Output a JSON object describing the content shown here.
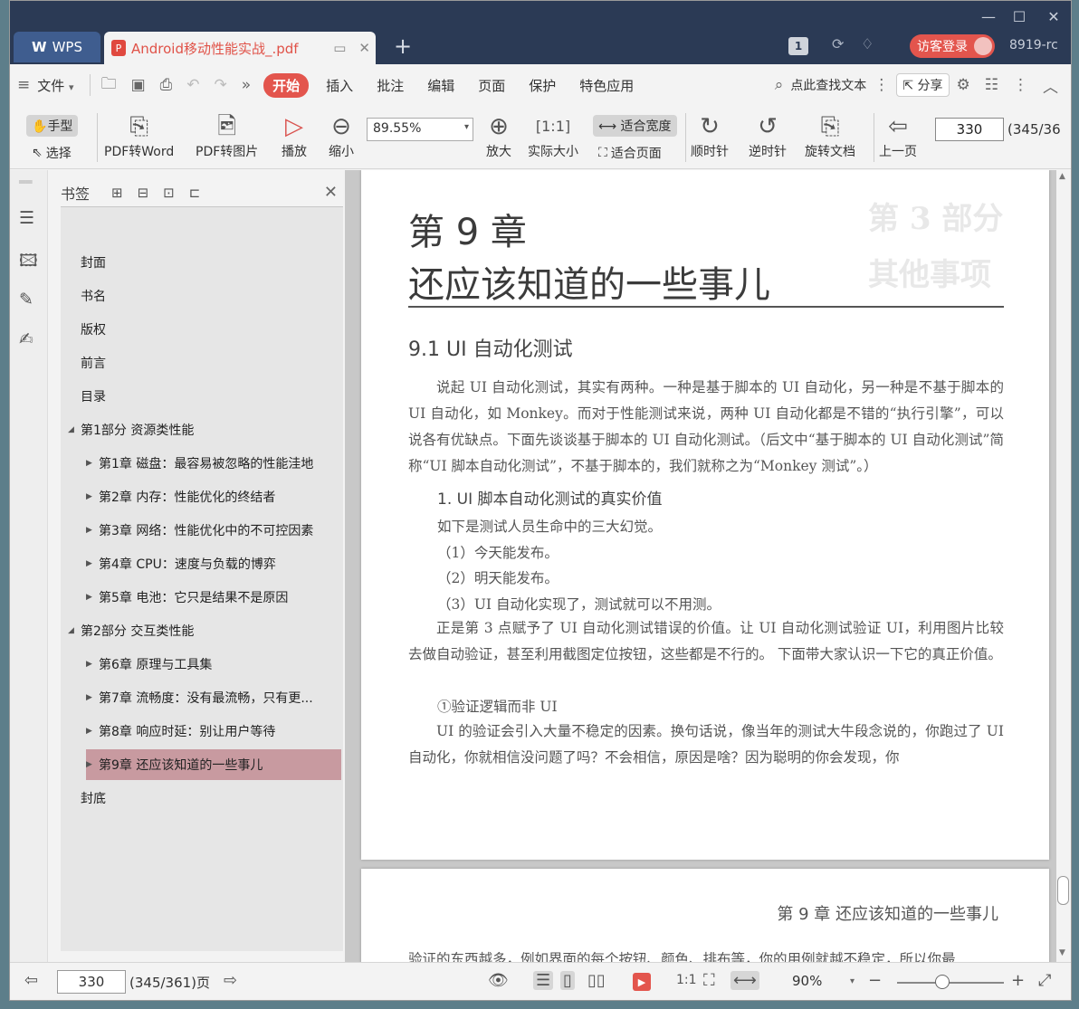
{
  "titlebar": {
    "app_tab": "WPS",
    "doc_tab": "Android移动性能实战_.pdf",
    "page_badge": "1",
    "guest_login": "访客登录",
    "user_code": "8919-rc"
  },
  "menu": {
    "file": "文件",
    "tabs": [
      "开始",
      "插入",
      "批注",
      "编辑",
      "页面",
      "保护",
      "特色应用"
    ],
    "search_text": "点此查找文本",
    "share": "分享"
  },
  "ribbon": {
    "hand": "手型",
    "select": "选择",
    "pdf_to_word": "PDF转Word",
    "pdf_to_image": "PDF转图片",
    "play": "播放",
    "zoom_out": "缩小",
    "zoom_value": "89.55%",
    "zoom_in": "放大",
    "actual_size": "实际大小",
    "fit_width": "适合宽度",
    "fit_page": "适合页面",
    "rotate_cw": "顺时针",
    "rotate_ccw": "逆时针",
    "rotate_doc": "旋转文档",
    "prev_page": "上一页",
    "page_current": "330",
    "page_total": "(345/36"
  },
  "bookmarks": {
    "title": "书签",
    "items": [
      {
        "label": "封面",
        "level": 0,
        "arrow": ""
      },
      {
        "label": "书名",
        "level": 0,
        "arrow": ""
      },
      {
        "label": "版权",
        "level": 0,
        "arrow": ""
      },
      {
        "label": "前言",
        "level": 0,
        "arrow": ""
      },
      {
        "label": "目录",
        "level": 0,
        "arrow": ""
      },
      {
        "label": "第1部分  资源类性能",
        "level": 0,
        "arrow": "◢"
      },
      {
        "label": "第1章  磁盘：最容易被忽略的性能洼地",
        "level": 1,
        "arrow": "▶"
      },
      {
        "label": "第2章  内存：性能优化的终结者",
        "level": 1,
        "arrow": "▶"
      },
      {
        "label": "第3章  网络：性能优化中的不可控因素",
        "level": 1,
        "arrow": "▶"
      },
      {
        "label": "第4章  CPU：速度与负载的博弈",
        "level": 1,
        "arrow": "▶"
      },
      {
        "label": "第5章  电池：它只是结果不是原因",
        "level": 1,
        "arrow": "▶"
      },
      {
        "label": "第2部分  交互类性能",
        "level": 0,
        "arrow": "◢"
      },
      {
        "label": "第6章  原理与工具集",
        "level": 1,
        "arrow": "▶"
      },
      {
        "label": "第7章  流畅度：没有最流畅，只有更...",
        "level": 1,
        "arrow": "▶"
      },
      {
        "label": "第8章  响应时延：别让用户等待",
        "level": 1,
        "arrow": "▶"
      },
      {
        "label": "第9章  还应该知道的一些事儿",
        "level": 1,
        "arrow": "▶",
        "selected": true
      },
      {
        "label": "封底",
        "level": 0,
        "arrow": ""
      }
    ]
  },
  "document": {
    "chapter_number": "第 9 章",
    "chapter_title": "还应该知道的一些事儿",
    "ghost_a": "第 3 部分",
    "ghost_b": "其他事项",
    "section_title": "9.1   UI 自动化测试",
    "para1": "说起 UI 自动化测试，其实有两种。一种是基于脚本的 UI 自动化，另一种是不基于脚本的 UI 自动化，如 Monkey。而对于性能测试来说，两种 UI 自动化都是不错的“执行引擎”，可以说各有优缺点。下面先谈谈基于脚本的 UI 自动化测试。（后文中“基于脚本的 UI 自动化测试”简称“UI 脚本自动化测试”，不基于脚本的，我们就称之为“Monkey 测试”。）",
    "subhead1": "1.  UI 脚本自动化测试的真实价值",
    "line1": "如下是测试人员生命中的三大幻觉。",
    "line2": "（1）今天能发布。",
    "line3": "（2）明天能发布。",
    "line4": "（3）UI 自动化实现了，测试就可以不用测。",
    "para2": "正是第 3 点赋予了 UI 自动化测试错误的价值。让 UI 自动化测试验证 UI，利用图片比较去做自动验证，甚至利用截图定位按钮，这些都是不行的。 下面带大家认识一下它的真正价值。",
    "line5": "①验证逻辑而非 UI",
    "para3": "UI 的验证会引入大量不稳定的因素。换句话说，像当年的测试大牛段念说的，你跑过了 UI 自动化，你就相信没问题了吗？不会相信，原因是啥？因为聪明的你会发现，你",
    "page2_header": "第 9 章    还应该知道的一些事儿",
    "page2_cut": "验证的东西越多，例如界面的每个按钮、颜色、排布等，你的用例就越不稳定，所以你最"
  },
  "statusbar": {
    "page_current": "330",
    "page_total": "(345/361)页",
    "zoom": "90%"
  }
}
